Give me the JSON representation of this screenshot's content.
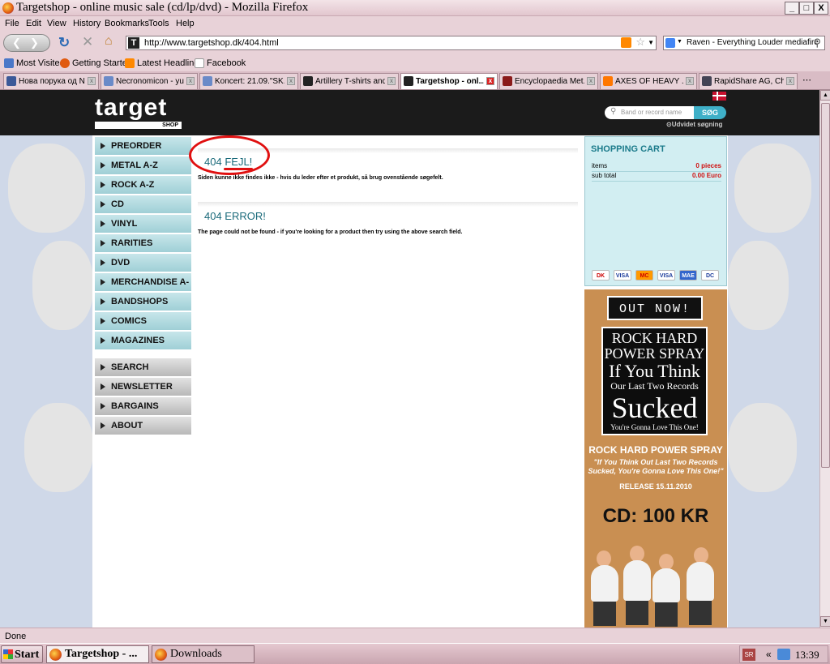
{
  "window": {
    "title": "Targetshop - online music sale (cd/lp/dvd) - Mozilla Firefox",
    "min": "_",
    "max": "□",
    "close": "X"
  },
  "menu": [
    "File",
    "Edit",
    "View",
    "History",
    "Bookmarks",
    "Tools",
    "Help"
  ],
  "navbar": {
    "url": "http://www.targetshop.dk/404.html",
    "search_engine_text": "Raven - Everything Louder mediafire"
  },
  "bookmarks": [
    "Most Visited",
    "Getting Started",
    "Latest Headlines",
    "Facebook"
  ],
  "tabs": [
    {
      "label": "Нова порука од N..."
    },
    {
      "label": "Necronomicon - yu..."
    },
    {
      "label": "Koncert: 21.09.\"SK..."
    },
    {
      "label": "Artillery T-shirts and ..."
    },
    {
      "label": "Targetshop - onl..."
    },
    {
      "label": "Encyclopaedia Met..."
    },
    {
      "label": "AXES OF HEAVY ..."
    },
    {
      "label": "RapidShare AG, Ch..."
    }
  ],
  "site": {
    "logo_text": "target",
    "logo_sub": "SHOP",
    "search_placeholder": "Band or record name",
    "search_button": "SØG",
    "advanced_search": "Udvidet søgning"
  },
  "nav_main": [
    "PREORDER",
    "METAL A-Z",
    "ROCK A-Z",
    "CD",
    "VINYL",
    "RARITIES",
    "DVD",
    "MERCHANDISE A-Z",
    "BANDSHOPS",
    "COMICS",
    "MAGAZINES"
  ],
  "nav_secondary": [
    "SEARCH",
    "NEWSLETTER",
    "BARGAINS",
    "ABOUT"
  ],
  "main": {
    "heading_dk_prefix": "404",
    "heading_dk_word": "FEJL!",
    "message_dk": "Siden kunne ikke findes ikke - hvis du leder efter et produkt, så brug ovenstående søgefelt.",
    "heading_en": "404 ERROR!",
    "message_en": "The page could not be found - if you're looking for a product then try using the above search field."
  },
  "cart": {
    "title": "SHOPPING CART",
    "items_label": "items",
    "items_value": "0 pieces",
    "subtotal_label": "sub total",
    "subtotal_value": "0.00 Euro",
    "cards": [
      "DK",
      "VISA",
      "MC",
      "VISA",
      "MAE",
      "DC"
    ]
  },
  "ad": {
    "out_now": "OUT NOW!",
    "album_line1": "ROCK HARD POWER SPRAY",
    "album_line2": "If You Think",
    "album_line3": "Our Last Two Records",
    "album_line4": "Sucked",
    "album_line5": "You're Gonna Love This One!",
    "promo_band": "ROCK HARD POWER SPRAY",
    "promo_quote": "\"If You Think Out Last Two Records Sucked, You're Gonna Love This One!\"",
    "promo_release": "RELEASE 15.11.2010",
    "promo_price": "CD: 100 KR"
  },
  "status": "Done",
  "taskbar": {
    "start": "Start",
    "items": [
      "Targetshop - ...",
      "Downloads"
    ],
    "lang": "SR",
    "clock": "13:39"
  }
}
